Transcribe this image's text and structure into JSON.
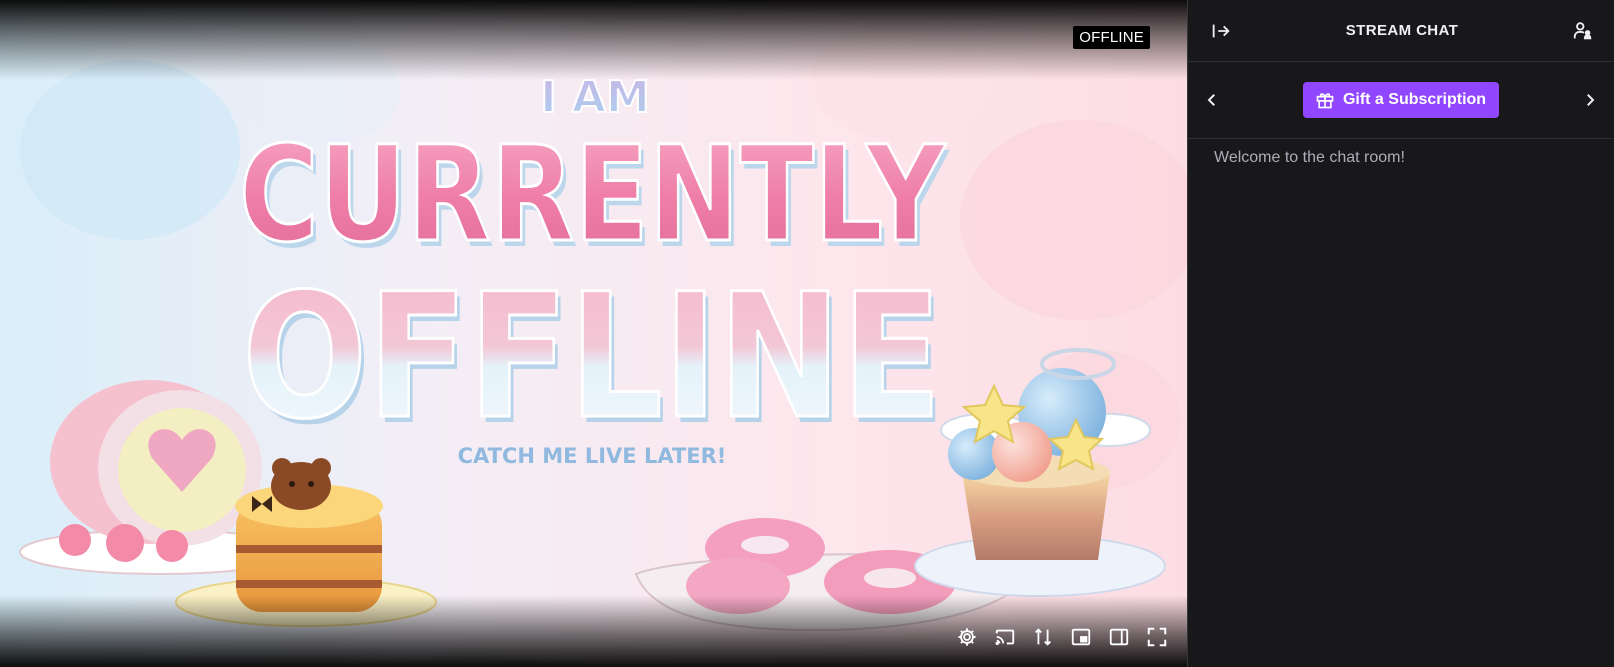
{
  "player": {
    "offline_badge": "OFFLINE",
    "banner": {
      "line1": "I AM",
      "line2": "CURRENTLY",
      "line3": "OFFLINE",
      "line4": "CATCH ME LIVE LATER!"
    },
    "controls": [
      {
        "name": "settings-icon"
      },
      {
        "name": "cast-icon"
      },
      {
        "name": "rotate-icon"
      },
      {
        "name": "mini-player-icon"
      },
      {
        "name": "theatre-mode-icon"
      },
      {
        "name": "fullscreen-icon"
      }
    ]
  },
  "chat": {
    "title": "STREAM CHAT",
    "collapse_icon": "collapse-arrow-icon",
    "users_icon": "community-icon",
    "gift_label": "Gift a Subscription",
    "gift_icon": "gift-icon",
    "welcome": "Welcome to the chat room!"
  },
  "colors": {
    "accent": "#9147ff",
    "chat_bg": "#18181b",
    "text_muted": "#adadb8",
    "text_primary": "#efeff1"
  }
}
